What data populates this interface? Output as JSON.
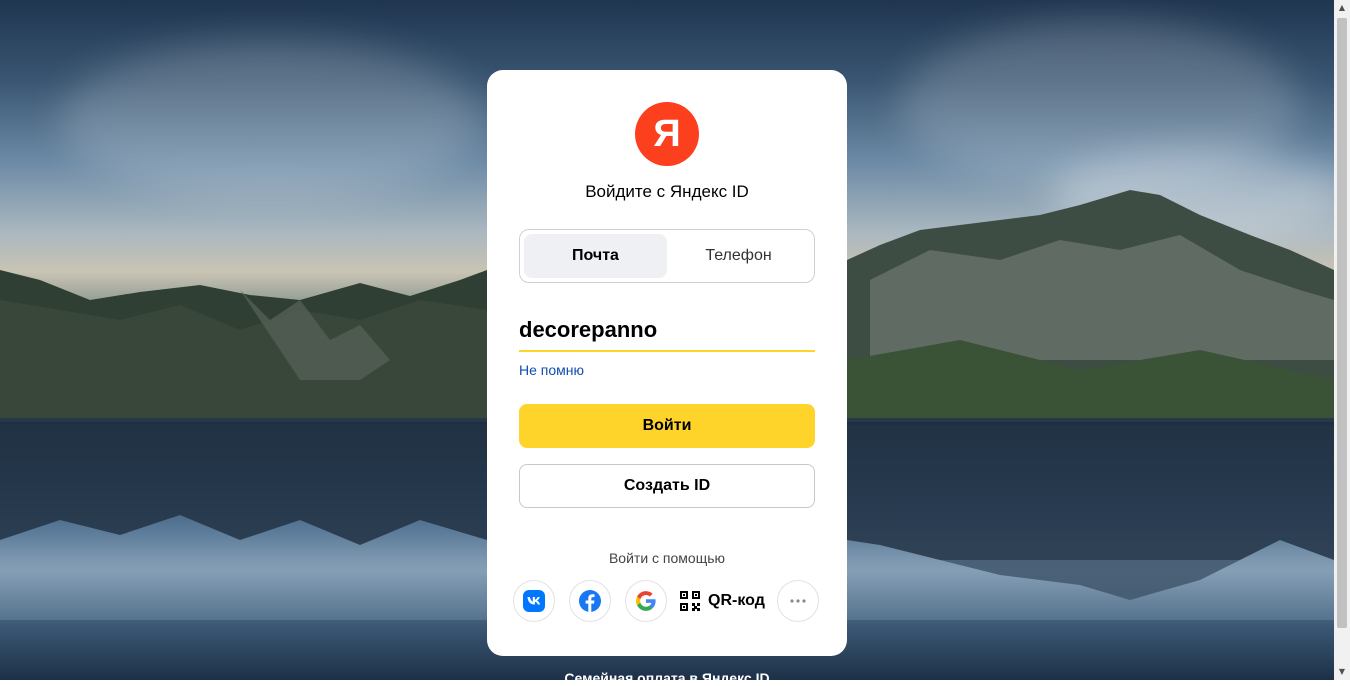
{
  "brand": {
    "logo_letter": "Я",
    "accent": "#fc3f1d",
    "primary": "#fed42b"
  },
  "title": "Войдите с Яндекс ID",
  "tabs": [
    {
      "label": "Почта",
      "active": true
    },
    {
      "label": "Телефон",
      "active": false
    }
  ],
  "login": {
    "value": "decorepanno"
  },
  "forgot_label": "Не помню",
  "buttons": {
    "login": "Войти",
    "create": "Создать ID"
  },
  "social": {
    "caption": "Войти с помощью",
    "providers": [
      {
        "name": "vk",
        "icon": "vk-icon"
      },
      {
        "name": "facebook",
        "icon": "facebook-icon"
      },
      {
        "name": "google",
        "icon": "google-icon"
      }
    ],
    "qr_label": "QR-код",
    "more_icon": "more-dots-icon"
  },
  "footer_link": "Семейная оплата в Яндекс ID"
}
